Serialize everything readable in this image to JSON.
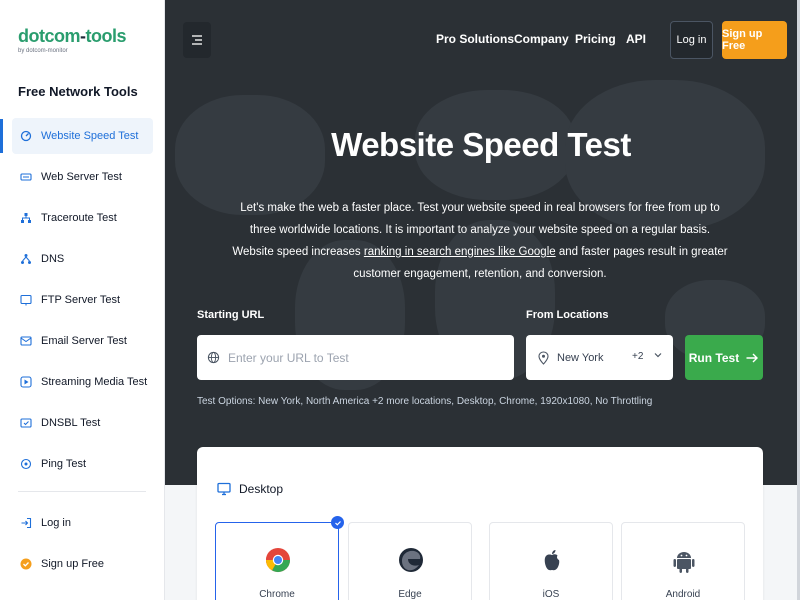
{
  "brand": {
    "name_part1": "dotcom",
    "name_sep": "-",
    "name_part2": "tools",
    "sub": "by dotcom-monitor"
  },
  "sidebar": {
    "section_title": "Free Network Tools",
    "items": [
      {
        "label": "Website Speed Test",
        "icon": "speedometer-icon"
      },
      {
        "label": "Web Server Test",
        "icon": "http-icon"
      },
      {
        "label": "Traceroute Test",
        "icon": "network-icon"
      },
      {
        "label": "DNS",
        "icon": "dns-icon"
      },
      {
        "label": "FTP Server Test",
        "icon": "ftp-icon"
      },
      {
        "label": "Email Server Test",
        "icon": "email-icon"
      },
      {
        "label": "Streaming Media Test",
        "icon": "play-icon"
      },
      {
        "label": "DNSBL Test",
        "icon": "blacklist-icon"
      },
      {
        "label": "Ping Test",
        "icon": "ping-icon"
      }
    ],
    "login": "Log in",
    "signup": "Sign up Free"
  },
  "topnav": {
    "links": [
      "Pro Solutions",
      "Company",
      "Pricing",
      "API"
    ],
    "login": "Log in",
    "signup": "Sign up Free"
  },
  "hero": {
    "title": "Website Speed Test",
    "desc_part1": "Let's make the web a faster place. Test your website speed in real browsers for free from up to three worldwide locations. It is important to analyze your website speed on a regular basis. Website speed increases ",
    "desc_link": "ranking in search engines like Google",
    "desc_part2": " and faster pages result in greater customer engagement, retention, and conversion."
  },
  "form": {
    "url_label": "Starting URL",
    "url_placeholder": "Enter your URL to Test",
    "loc_label": "From Locations",
    "location": "New York",
    "more": "+2",
    "run": "Run Test",
    "test_options": "Test Options: New York, North America +2 more locations, Desktop, Chrome, 1920x1080, No Throttling"
  },
  "device": {
    "title": "Desktop",
    "browsers": [
      {
        "name": "Chrome",
        "selected": true
      },
      {
        "name": "Edge",
        "selected": false
      },
      {
        "name": "iOS",
        "selected": false
      },
      {
        "name": "Android",
        "selected": false
      }
    ]
  },
  "colors": {
    "accent": "#1e6fd9",
    "brand": "#2a9d6e",
    "cta": "#f59e1b",
    "run": "#3aaa4c",
    "hero_bg": "#2b3035"
  }
}
